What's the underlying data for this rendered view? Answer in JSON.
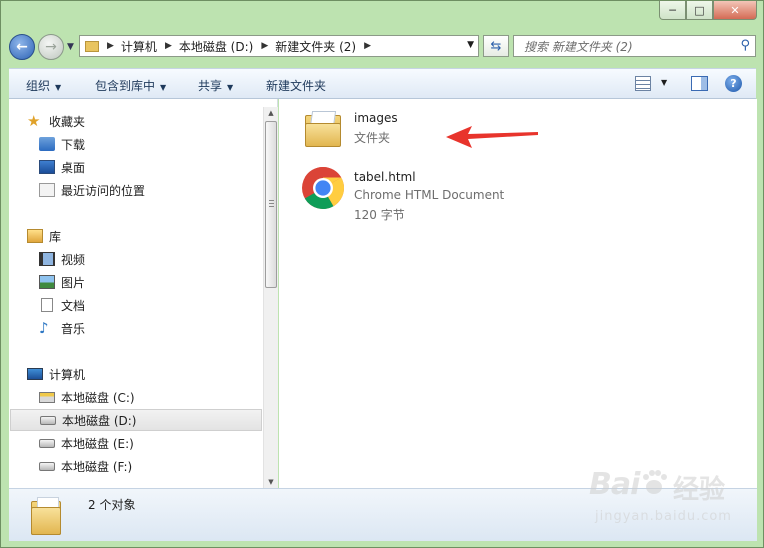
{
  "window": {
    "controls": {
      "minimize": "─",
      "maximize": "□",
      "close": "✕"
    }
  },
  "nav": {
    "back_glyph": "←",
    "forward_glyph": "→",
    "breadcrumb": [
      "计算机",
      "本地磁盘 (D:)",
      "新建文件夹 (2)"
    ],
    "search_placeholder": "搜索 新建文件夹 (2)"
  },
  "toolbar": {
    "organize": "组织",
    "include_library": "包含到库中",
    "share": "共享",
    "new_folder": "新建文件夹"
  },
  "sidebar": {
    "favorites": {
      "label": "收藏夹",
      "items": [
        "下载",
        "桌面",
        "最近访问的位置"
      ]
    },
    "libraries": {
      "label": "库",
      "items": [
        "视频",
        "图片",
        "文档",
        "音乐"
      ]
    },
    "computer": {
      "label": "计算机",
      "items": [
        "本地磁盘 (C:)",
        "本地磁盘 (D:)",
        "本地磁盘 (E:)",
        "本地磁盘 (F:)"
      ],
      "selected": "本地磁盘 (D:)"
    }
  },
  "files": [
    {
      "name": "images",
      "type": "文件夹",
      "icon": "folder-icon"
    },
    {
      "name": "tabel.html",
      "type": "Chrome HTML Document",
      "size": "120 字节",
      "icon": "chrome-icon"
    }
  ],
  "annotation": {
    "color": "#e8342c"
  },
  "status": {
    "count": "2 个对象"
  },
  "watermark": {
    "logo": "Bai",
    "cn": "经验",
    "url": "jingyan.baidu.com"
  }
}
